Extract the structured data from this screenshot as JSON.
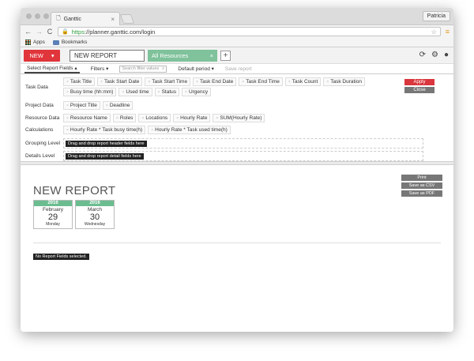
{
  "browser": {
    "tab_title": "Ganttic",
    "tab_close": "×",
    "profile": "Patricia",
    "url_https": "https",
    "url_rest": "://planner.ganttic.com/login",
    "bookmarks": {
      "apps": "Apps",
      "bookmarks": "Bookmarks"
    }
  },
  "header": {
    "new_label": "NEW",
    "new_caret": "▾",
    "report_tab": "NEW REPORT",
    "resources_tab": "All Resources",
    "resources_close": "×",
    "add": "+"
  },
  "reportbar": {
    "select_fields": "Select Report Fields ▴",
    "filters": "Filters ▾",
    "filter_placeholder": "Search filter values",
    "default_period": "Default period ▾",
    "save_report": "Save report"
  },
  "fields": {
    "task_data": {
      "label": "Task Data",
      "chips": [
        "Task Title",
        "Task Start Date",
        "Task Start Time",
        "Task End Date",
        "Task End Time",
        "Task Count",
        "Task Duration",
        "Busy time (hh:mm)",
        "Used time",
        "Status",
        "Urgency"
      ]
    },
    "project_data": {
      "label": "Project Data",
      "chips": [
        "Project Title",
        "Deadline"
      ]
    },
    "resource_data": {
      "label": "Resource Data",
      "chips": [
        "Resource Name",
        "Roles",
        "Locations",
        "Hourly Rate",
        "SUM(Hourly Rate)"
      ]
    },
    "calculations": {
      "label": "Calculations",
      "chips": [
        "Hourly Rate * Task busy time(h)",
        "Hourly Rate * Task used time(h)"
      ]
    },
    "grouping": {
      "label": "Grouping Level",
      "hint": "Drag and drop report header fields here"
    },
    "details": {
      "label": "Details Level",
      "hint": "Drag and drop report detail fields here"
    },
    "apply": "Apply",
    "close": "Close"
  },
  "report": {
    "title": "NEW REPORT",
    "start": {
      "year": "2016",
      "month": "February",
      "day": "29",
      "weekday": "Monday"
    },
    "end": {
      "year": "2016",
      "month": "March",
      "day": "30",
      "weekday": "Wednesday"
    },
    "print": "Print",
    "save_csv": "Save as CSV",
    "save_pdf": "Save as PDF",
    "no_fields": "No Report Fields selected."
  }
}
